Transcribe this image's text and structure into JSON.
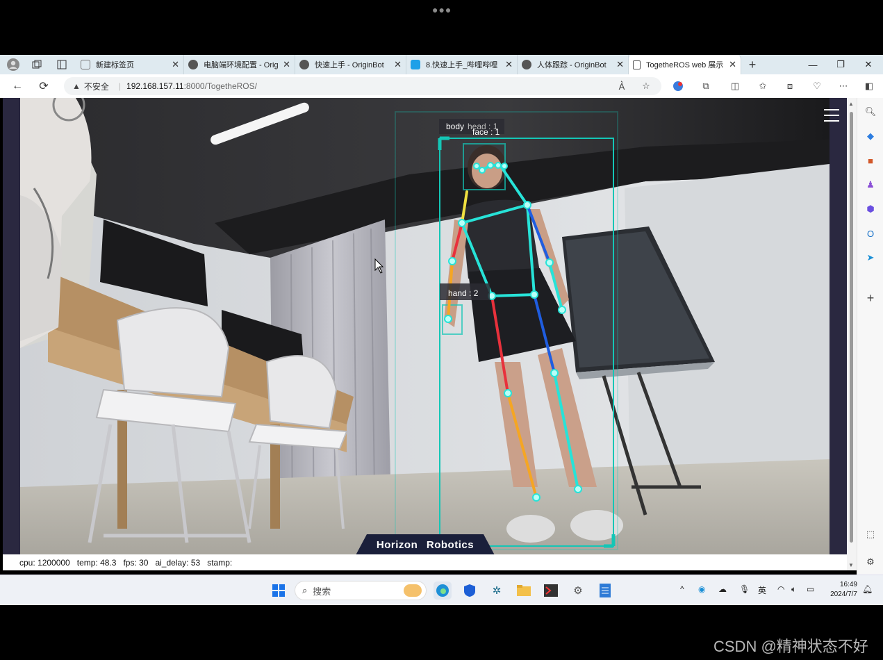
{
  "tabs": [
    {
      "title": "新建标签页",
      "active": false
    },
    {
      "title": "电脑端环境配置 - Orig",
      "active": false
    },
    {
      "title": "快速上手 - OriginBot",
      "active": false
    },
    {
      "title": "8.快速上手_哔哩哔哩",
      "active": false
    },
    {
      "title": "人体跟踪 - OriginBot",
      "active": false
    },
    {
      "title": "TogetheROS web 展示",
      "active": true
    }
  ],
  "address_bar": {
    "security_label": "不安全",
    "url_host": "192.168.157.11",
    "url_rest": ":8000/TogetheROS/"
  },
  "detections": {
    "body_label": "body",
    "head_label": "head : 1",
    "face_label": "face : 1",
    "hand_label": "hand : 2"
  },
  "brand": "Horizon Robotics",
  "status": {
    "cpu": "cpu: 1200000",
    "temp": "temp: 48.3",
    "fps": "fps: 30",
    "ai_delay": "ai_delay: 53",
    "stamp": "stamp:"
  },
  "taskbar": {
    "search_placeholder": "搜索",
    "ime": "英",
    "time": "16:49",
    "date": "2024/7/7"
  },
  "watermark": "CSDN @精神状态不好",
  "colors": {
    "skeleton": "#27e3d8",
    "left_limb": "#e8313c",
    "right_limb": "#1f5de0",
    "lower_left": "#f5a623",
    "neck": "#f0e040",
    "brand_bg": "#1a1f3a"
  }
}
